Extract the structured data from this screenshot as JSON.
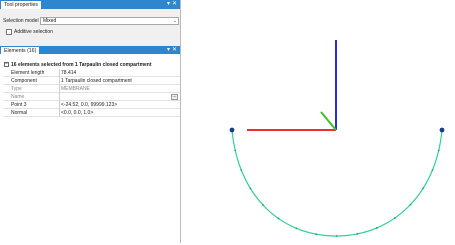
{
  "tool_properties": {
    "tab_label": "Tool properties",
    "pin_icon": "pin-icon",
    "close_icon": "close-icon",
    "selection_model_label": "Selection model",
    "selection_model_value": "Mixed",
    "additive_selection_label": "Additive selection",
    "additive_selection_checked": false
  },
  "elements_panel": {
    "tab_label": "Elements (16)",
    "group_title": "16 elements selected from 1 Tarpaulin closed compartment",
    "properties": [
      {
        "key": "Element length",
        "value": "78.414",
        "greyed": false,
        "has_button": false
      },
      {
        "key": "Component",
        "value": "1 Tarpaulin closed compartment",
        "greyed": false,
        "has_button": false
      },
      {
        "key": "Type",
        "value": "MEMBRANE",
        "greyed": true,
        "has_button": false
      },
      {
        "key": "Name",
        "value": "",
        "greyed": true,
        "has_button": true
      },
      {
        "key": "Point 3",
        "value": "<-24.52, 0.0, 99999.123>",
        "greyed": false,
        "has_button": false
      },
      {
        "key": "Normal",
        "value": "<0.0, 0.0, 1.0>",
        "greyed": false,
        "has_button": false
      }
    ],
    "ellipsis_label": "..."
  },
  "viewport": {
    "axis_colors": {
      "x": "#e8302b",
      "y": "#3fbf2a",
      "z": "#2a2ad2"
    },
    "curve_color": "#2ecf98",
    "node_color": "#1a3c88"
  }
}
